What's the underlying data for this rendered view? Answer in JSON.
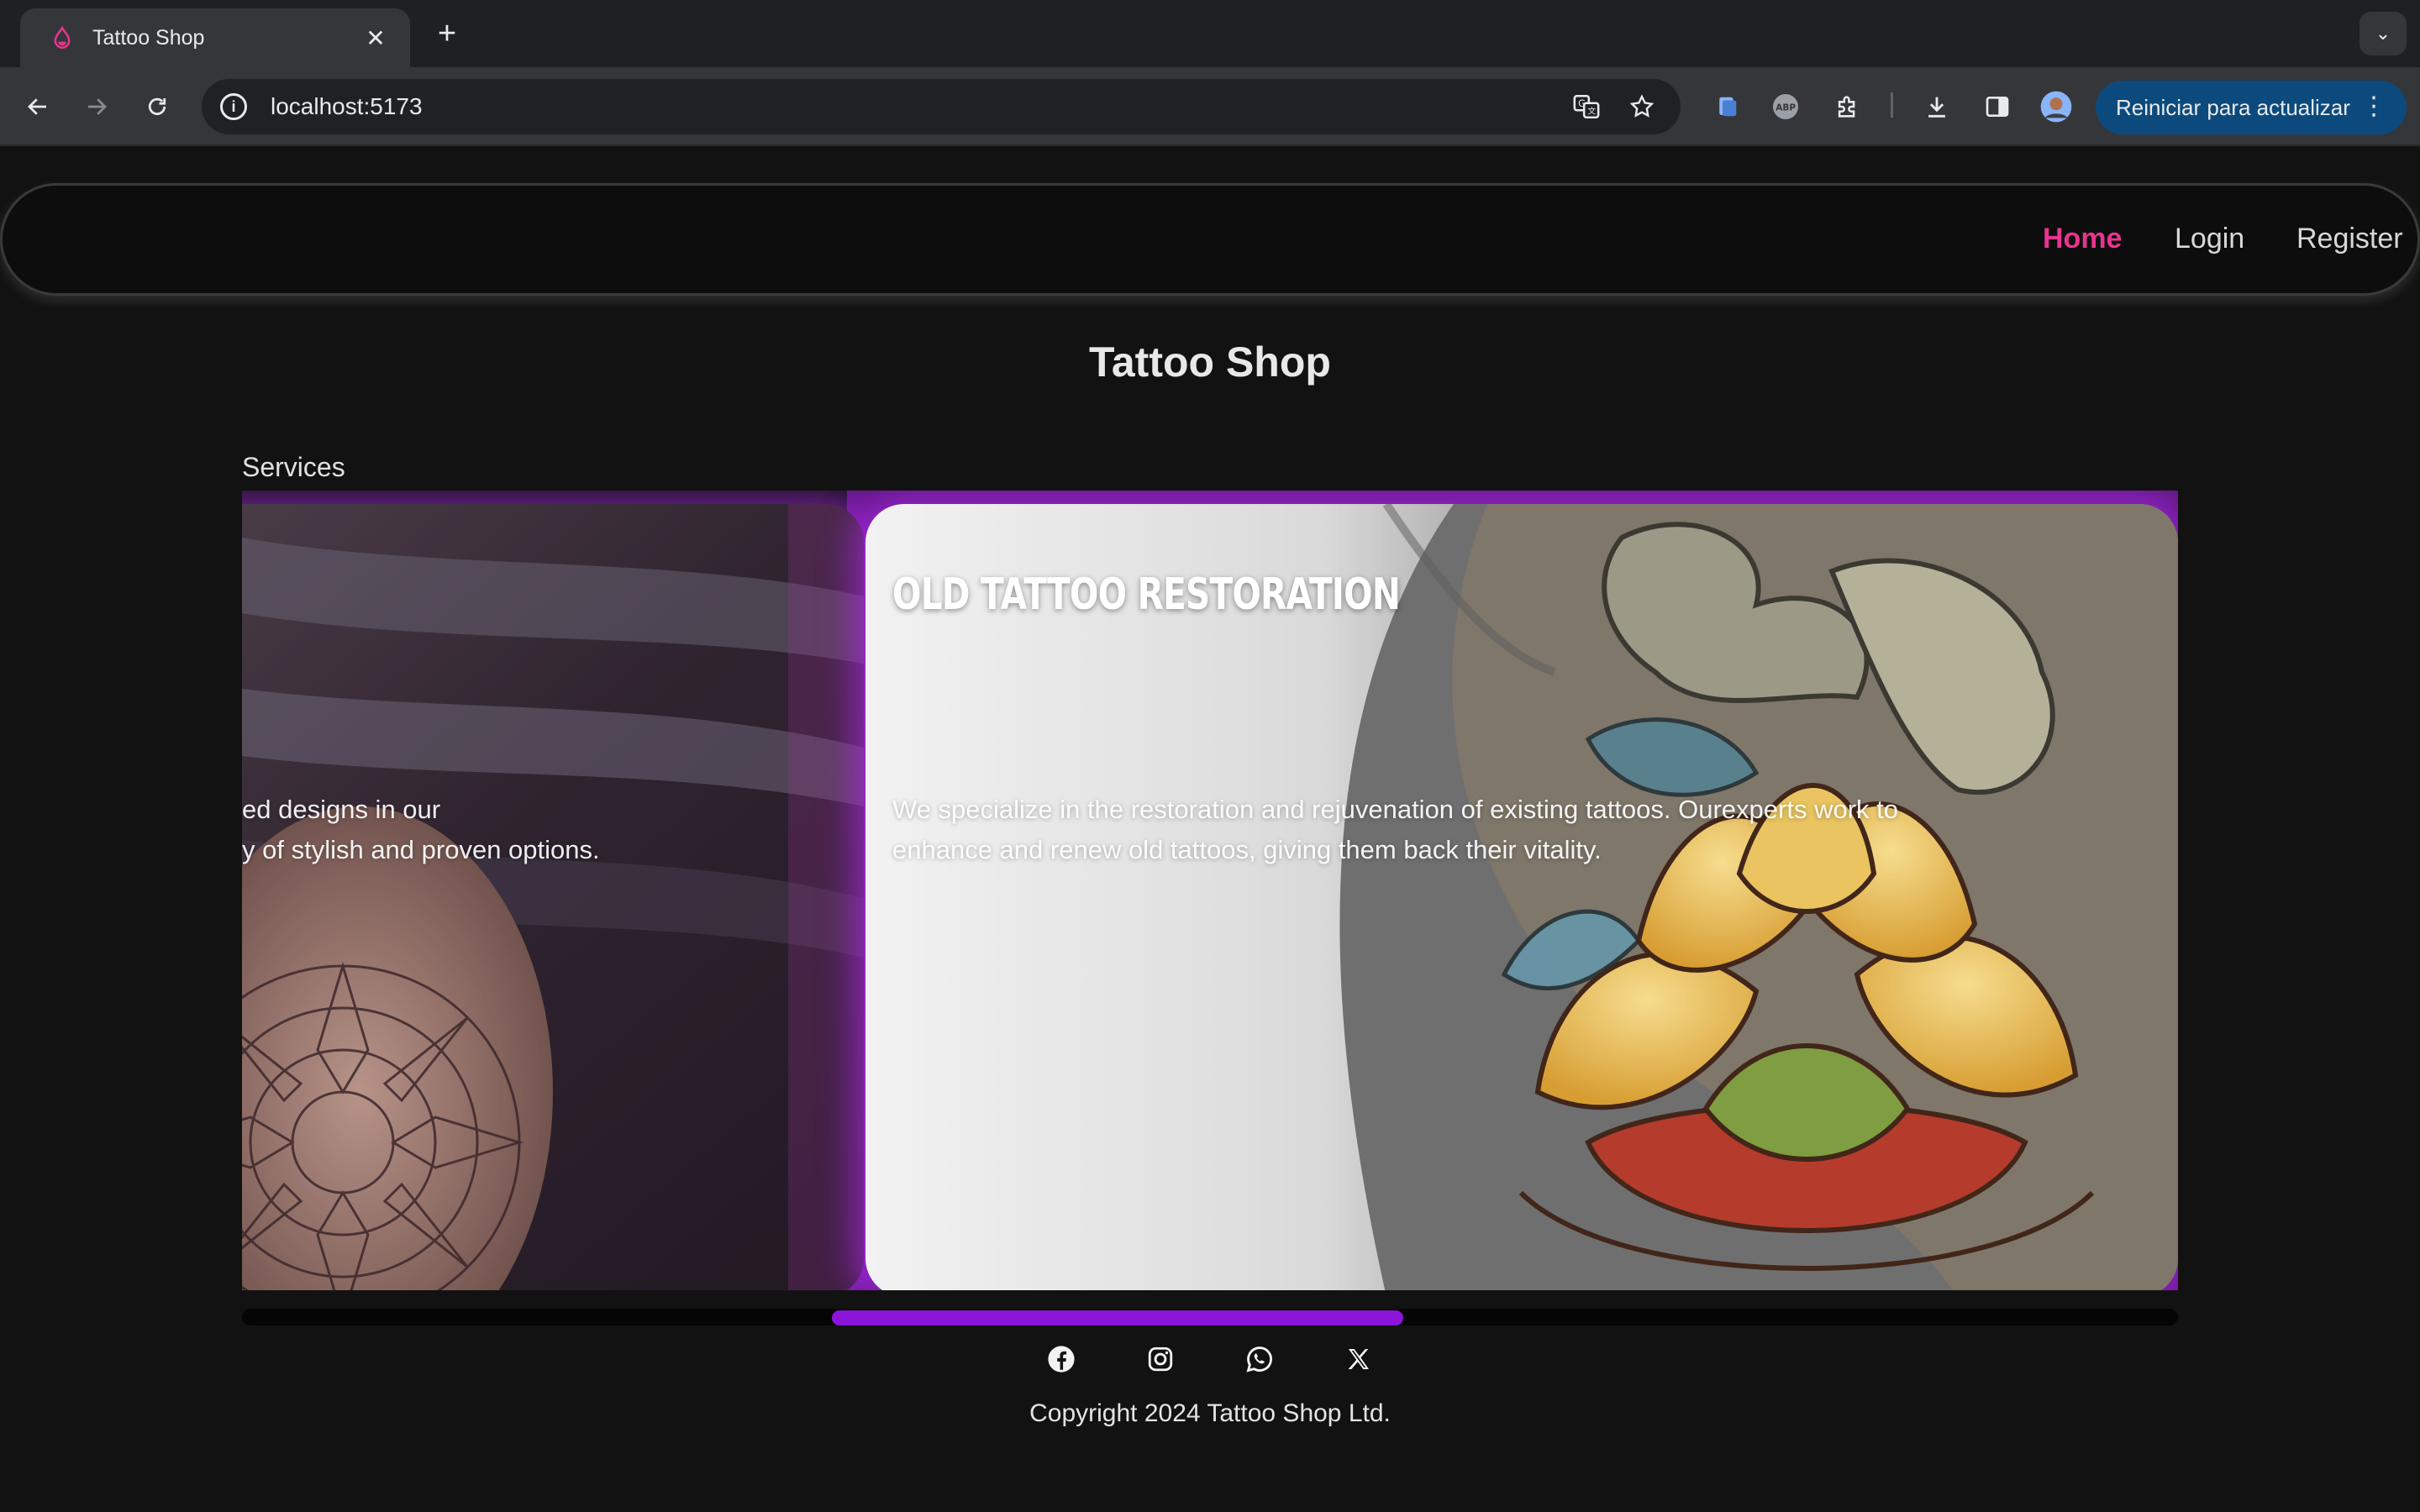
{
  "browser": {
    "tab_title": "Tattoo Shop",
    "url": "localhost:5173",
    "update_button_label": "Reiniciar para actualizar",
    "icons": [
      "back-icon",
      "forward-icon",
      "reload-icon",
      "site-info-icon",
      "translate-icon",
      "bookmark-star-icon",
      "extension-docs-icon",
      "adblock-icon",
      "extensions-puzzle-icon",
      "download-icon",
      "side-panel-icon",
      "profile-avatar",
      "menu-dots-icon"
    ]
  },
  "nav": {
    "items": [
      {
        "label": "Home",
        "active": true
      },
      {
        "label": "Login",
        "active": false
      },
      {
        "label": "Register",
        "active": false
      }
    ],
    "accent_color": "#e8348e"
  },
  "main": {
    "title": "Tattoo Shop",
    "section_label": "Services",
    "cards": [
      {
        "title": "",
        "description_line1": "ed designs in our",
        "description_line2": "y of stylish and proven options."
      },
      {
        "title": "OLD TATTOO RESTORATION",
        "description": "We specialize in the restoration and rejuvenation of existing tattoos. Ourexperts work to enhance and renew old tattoos, giving them back their vitality."
      }
    ],
    "carousel_scroll_position": 0.3,
    "accent_color": "#8a14d8"
  },
  "footer": {
    "socials": [
      "facebook-icon",
      "instagram-icon",
      "whatsapp-icon",
      "x-twitter-icon"
    ],
    "copyright": "Copyright 2024 Tattoo Shop Ltd."
  }
}
